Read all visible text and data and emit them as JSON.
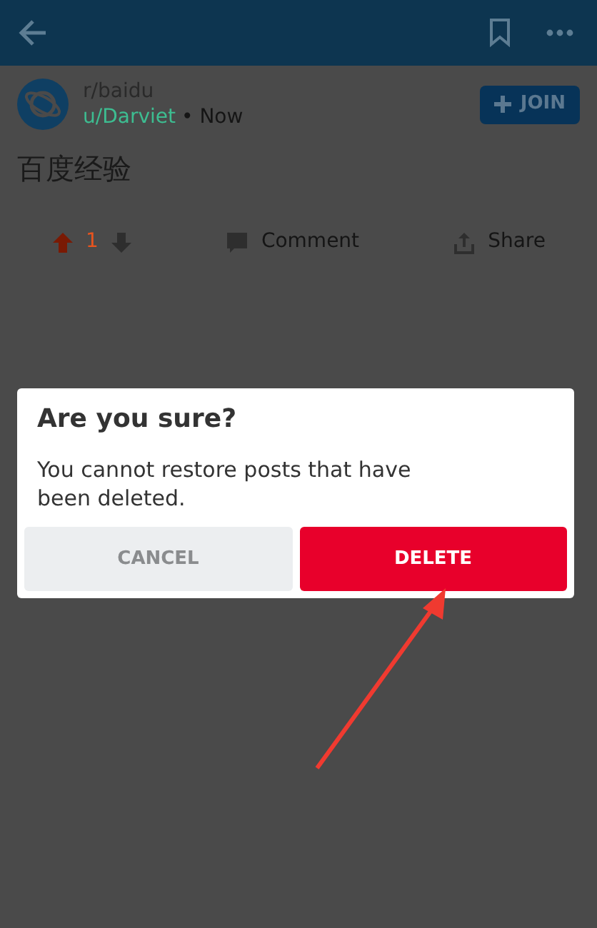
{
  "post": {
    "subreddit": "r/baidu",
    "author": "u/Darviet",
    "time": "• Now",
    "join_label": "JOIN",
    "title": "百度经验",
    "score": "1",
    "upvoted": true,
    "actions": [
      {
        "kind": "comment",
        "label": "Comment"
      },
      {
        "kind": "share",
        "label": "Share"
      }
    ]
  },
  "dialog": {
    "title": "Are you sure?",
    "message": "You cannot restore posts that have been deleted.",
    "buttons": [
      {
        "kind": "cancel",
        "label": "CANCEL"
      },
      {
        "kind": "delete",
        "label": "DELETE"
      }
    ]
  }
}
